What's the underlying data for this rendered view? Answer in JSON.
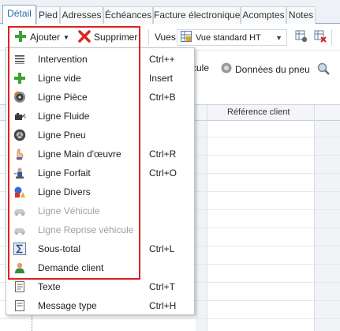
{
  "tabs": [
    {
      "label": "Détail",
      "active": true
    },
    {
      "label": "Pied"
    },
    {
      "label": "Adresses"
    },
    {
      "label": "Échéances"
    },
    {
      "label": "Facture électronique"
    },
    {
      "label": "Acomptes"
    },
    {
      "label": "Notes"
    }
  ],
  "toolbar": {
    "add_label": "Ajouter",
    "delete_label": "Supprimer",
    "views_label": "Vues",
    "view_value": "Vue standard HT"
  },
  "toolbar2": {
    "vehicle_partial": "cule",
    "tire_data": "Données du pneu"
  },
  "grid": {
    "column_header": "Référence client"
  },
  "menu": {
    "items": [
      {
        "label": "Intervention",
        "shortcut": "Ctrl++",
        "icon": "list-icon"
      },
      {
        "label": "Ligne vide",
        "shortcut": "Insert",
        "icon": "plus-icon"
      },
      {
        "label": "Ligne Pièce",
        "shortcut": "Ctrl+B",
        "icon": "brake-disc-icon"
      },
      {
        "label": "Ligne Fluide",
        "shortcut": "",
        "icon": "oil-can-icon"
      },
      {
        "label": "Ligne Pneu",
        "shortcut": "",
        "icon": "tire-icon"
      },
      {
        "label": "Ligne Main d'œuvre",
        "shortcut": "Ctrl+R",
        "icon": "hand-icon"
      },
      {
        "label": "Ligne Forfait",
        "shortcut": "Ctrl+O",
        "icon": "mechanic-icon"
      },
      {
        "label": "Ligne Divers",
        "shortcut": "",
        "icon": "shapes-icon"
      },
      {
        "label": "Ligne Véhicule",
        "shortcut": "",
        "icon": "car-icon",
        "disabled": true
      },
      {
        "label": "Ligne Reprise véhicule",
        "shortcut": "",
        "icon": "car-return-icon",
        "disabled": true
      },
      {
        "label": "Sous-total",
        "shortcut": "Ctrl+L",
        "icon": "sigma-icon"
      },
      {
        "label": "Demande client",
        "shortcut": "",
        "icon": "person-icon"
      },
      {
        "label": "Texte",
        "shortcut": "Ctrl+T",
        "icon": "text-icon"
      },
      {
        "label": "Message type",
        "shortcut": "Ctrl+H",
        "icon": "message-icon"
      }
    ]
  },
  "colors": {
    "highlight": "#e02020",
    "tab_active_text": "#2a6ab0",
    "disabled_text": "#9aa1a8"
  }
}
